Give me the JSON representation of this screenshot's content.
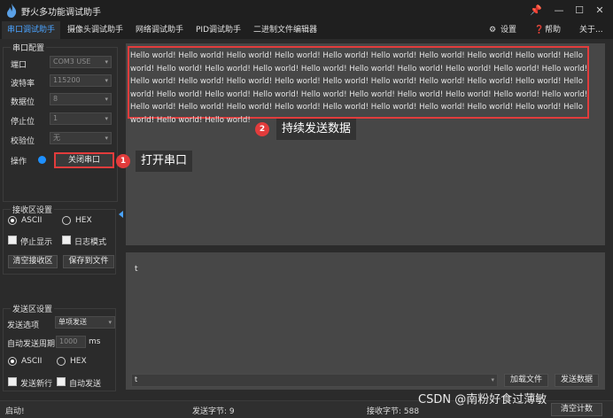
{
  "window": {
    "title": "野火多功能调试助手",
    "controls": [
      "pin-icon",
      "minimize-icon",
      "maximize-icon",
      "close-icon"
    ]
  },
  "tabs": [
    {
      "label": "串口调试助手",
      "active": true
    },
    {
      "label": "摄像头调试助手",
      "active": false
    },
    {
      "label": "网络调试助手",
      "active": false
    },
    {
      "label": "PID调试助手",
      "active": false
    },
    {
      "label": "二进制文件编辑器",
      "active": false
    }
  ],
  "tab_actions": {
    "settings": "设置",
    "help": "帮助",
    "about": "关于..."
  },
  "serial_config": {
    "group_title": "串口配置",
    "port": {
      "label": "端口",
      "value": "COM3 USE"
    },
    "baud": {
      "label": "波特率",
      "value": "115200"
    },
    "data_bits": {
      "label": "数据位",
      "value": "8"
    },
    "stop_bits": {
      "label": "停止位",
      "value": "1"
    },
    "parity": {
      "label": "校验位",
      "value": "无"
    },
    "operation": {
      "label": "操作",
      "button": "关闭串口",
      "status_color": "#1e90ff"
    }
  },
  "receive_settings": {
    "group_title": "接收区设置",
    "ascii": "ASCII",
    "hex": "HEX",
    "stop_display": "停止显示",
    "log_mode": "日志模式",
    "clear": "清空接收区",
    "save": "保存到文件"
  },
  "send_settings": {
    "group_title": "发送区设置",
    "option_label": "发送选项",
    "option_value": "单项发送",
    "auto_period_label": "自动发送周期",
    "auto_period_value": "1000",
    "auto_period_unit": "ms",
    "ascii": "ASCII",
    "hex": "HEX",
    "send_newline": "发送新行",
    "auto_send": "自动发送"
  },
  "receive_area": {
    "text": "Hello world! Hello world! Hello world! Hello world! Hello world! Hello world! Hello world! Hello world! Hello world! Hello world! Hello world! Hello world! Hello world! Hello world! Hello world! Hello world! Hello world! Hello world! Hello world! Hello world! Hello world! Hello world! Hello world! Hello world! Hello world! Hello world! Hello world! Hello world! Hello world! Hello world! Hello world! Hello world! Hello world! Hello world! Hello world! Hello world! Hello world! Hello world! Hello world! Hello world! Hello world! Hello world! Hello world! Hello world! Hello world! Hello world! Hello world! Hello world! Hello world! Hello world!"
  },
  "send_area": {
    "text": "t",
    "input_value": "t",
    "load_file": "加载文件",
    "send_data": "发送数据"
  },
  "status_bar": {
    "left": "启动!",
    "sent": "发送字节: 9",
    "received": "接收字节: 588",
    "clear_count": "清空计数"
  },
  "annotations": {
    "callout1_number": "1",
    "callout1_text": "打开串口",
    "callout2_number": "2",
    "callout2_text": "持续发送数据",
    "accent": "#e23c3c"
  },
  "watermark": "CSDN @南粉好食过薄敏"
}
